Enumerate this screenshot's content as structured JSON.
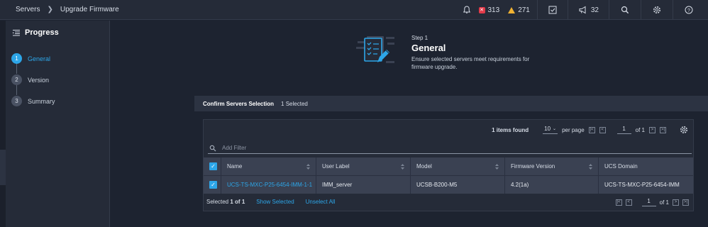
{
  "breadcrumb": {
    "parent": "Servers",
    "current": "Upgrade Firmware"
  },
  "topbar": {
    "critical_count": "313",
    "warning_count": "271",
    "announce_count": "32"
  },
  "progress": {
    "title": "Progress",
    "steps": [
      {
        "num": "1",
        "label": "General"
      },
      {
        "num": "2",
        "label": "Version"
      },
      {
        "num": "3",
        "label": "Summary"
      }
    ]
  },
  "step_header": {
    "step_no": "Step 1",
    "title": "General",
    "description": "Ensure selected servers meet requirements for firmware upgrade."
  },
  "confirm_bar": {
    "title": "Confirm Servers Selection",
    "selected": "1 Selected"
  },
  "table": {
    "items_found": "1 items found",
    "page_size": "10",
    "per_page_label": "per page",
    "page": "1",
    "of_pages": "of 1",
    "filter_placeholder": "Add Filter",
    "columns": [
      "Name",
      "User Label",
      "Model",
      "Firmware Version",
      "UCS Domain"
    ],
    "rows": [
      {
        "name": "UCS-TS-MXC-P25-6454-IMM-1-1",
        "user_label": "IMM_server",
        "model": "UCSB-B200-M5",
        "firmware": "4.2(1a)",
        "domain": "UCS-TS-MXC-P25-6454-IMM"
      }
    ],
    "selected_prefix": "Selected",
    "selected_count": "1 of 1",
    "show_selected": "Show Selected",
    "unselect_all": "Unselect All",
    "bottom_page": "1",
    "bottom_of": "of 1"
  },
  "colors": {
    "accent": "#2da6e8",
    "critical": "#e23b4a",
    "warning": "#f0b232"
  }
}
